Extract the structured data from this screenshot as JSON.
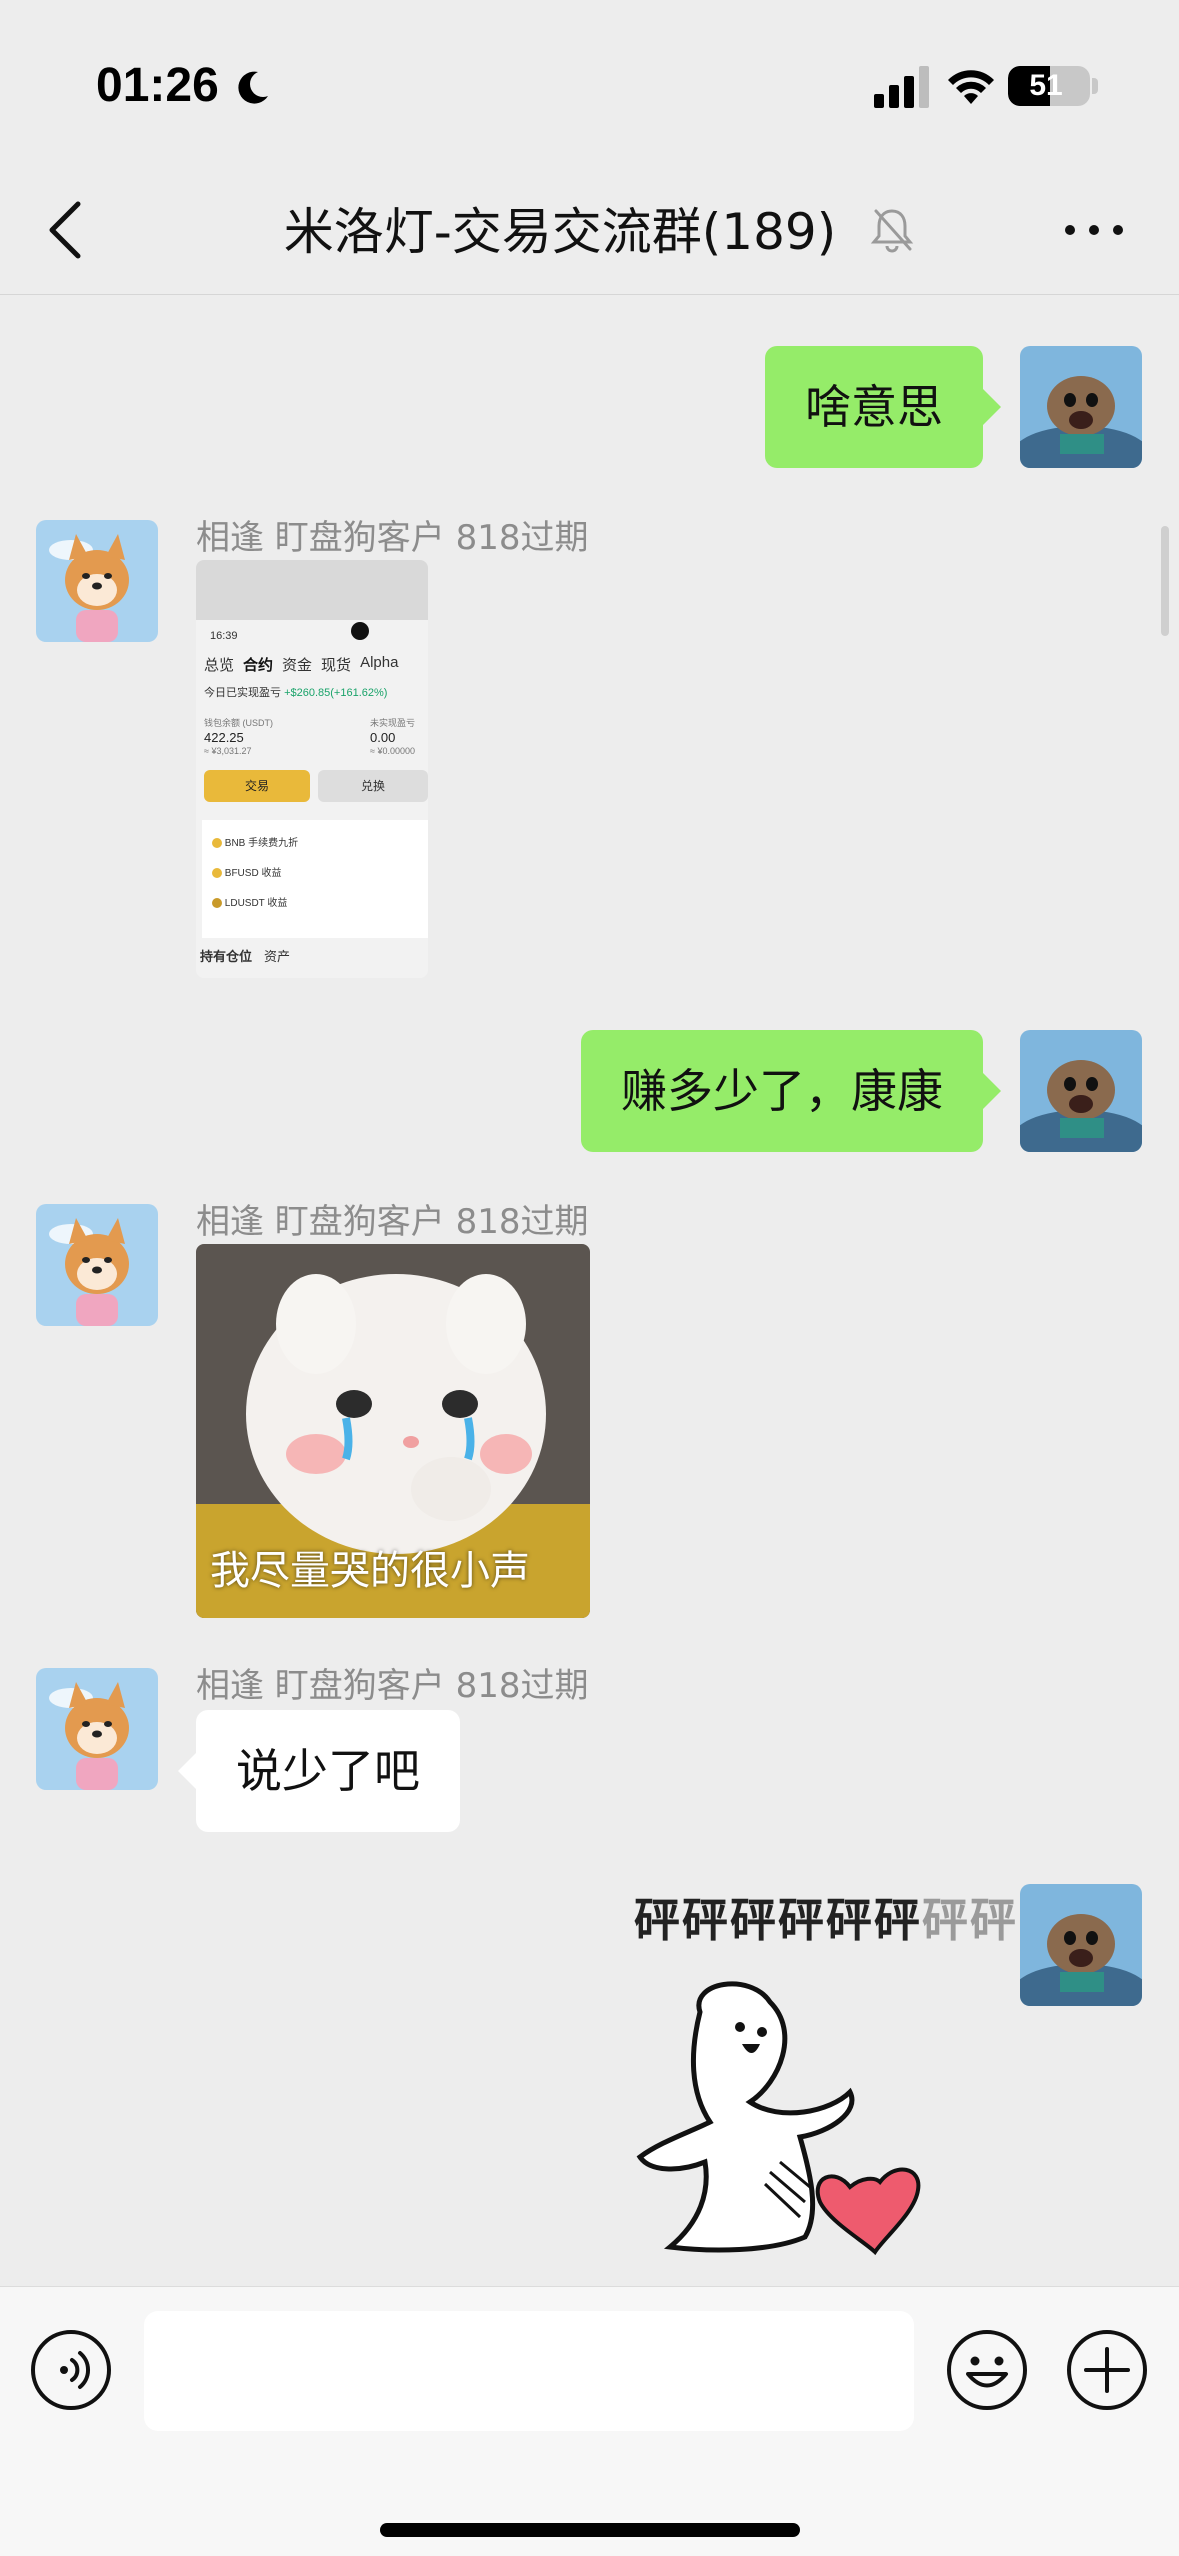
{
  "status_bar": {
    "time": "01:26",
    "battery": "51",
    "battery_level": 0.51
  },
  "nav": {
    "title": "米洛灯-交易交流群(189)"
  },
  "messages": [
    {
      "type": "text",
      "from": "me",
      "text": "啥意思"
    },
    {
      "type": "image",
      "from": "other",
      "sender": "相逢 盯盘狗客户 818过期",
      "screen": {
        "clock": "16:39",
        "tabs": [
          "总览",
          "合约",
          "资金",
          "现货",
          "Alpha"
        ],
        "pnl_label": "今日已实现盈亏",
        "pnl_value": "+$260.85(+161.62%)",
        "balance_label": "钱包余额 (USDT)",
        "balance_value": "422.25",
        "balance_usd": "≈ ¥3,031.27",
        "unrealized_label": "未实现盈亏",
        "unrealized_value": "0.00",
        "unrealized_cny": "≈ ¥0.00000",
        "trade_button": "交易",
        "convert_button": "兑换",
        "list": [
          "BNB 手续费九折",
          "BFUSD 收益",
          "LDUSDT 收益"
        ],
        "bottom_tabs": [
          "持有仓位",
          "资产"
        ]
      }
    },
    {
      "type": "text",
      "from": "me",
      "text": "赚多少了，康康"
    },
    {
      "type": "image",
      "from": "other",
      "sender": "相逢 盯盘狗客户 818过期",
      "caption": "我尽量哭的很小声"
    },
    {
      "type": "text",
      "from": "other",
      "sender": "相逢 盯盘狗客户 818过期",
      "text": "说少了吧"
    },
    {
      "type": "sticker",
      "from": "me",
      "text_main": "砰砰砰砰砰砰",
      "text_fade": "砰砰"
    }
  ],
  "colors": {
    "me_bubble": "#95ec69",
    "other_bubble": "#ffffff",
    "background": "#ededed",
    "sender_name": "#8c8c8c"
  },
  "icons": {
    "back": "chevron-left-icon",
    "mute": "bell-slash-icon",
    "more": "ellipsis-icon",
    "voice": "voice-icon",
    "emoji": "smile-icon",
    "plus": "plus-circle-icon"
  },
  "input": {
    "placeholder": ""
  }
}
